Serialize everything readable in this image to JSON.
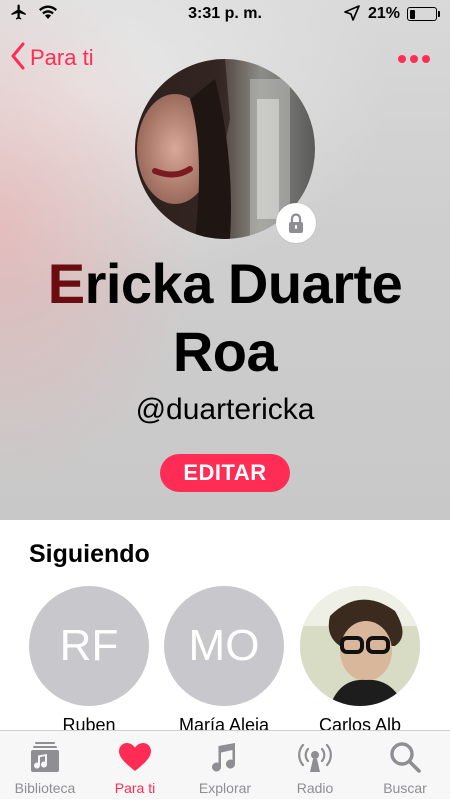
{
  "status_bar": {
    "time": "3:31 p. m.",
    "battery_text": "21%",
    "battery_level": 0.21
  },
  "nav": {
    "back_label": "Para ti",
    "more_icon": "more-dots-icon"
  },
  "profile": {
    "name_first_letter": "E",
    "name_first_rest": "ricka Duarte",
    "name_last": "Roa",
    "handle": "@duartericka",
    "edit_label": "EDITAR",
    "lock_icon": "lock-icon"
  },
  "following": {
    "title": "Siguiendo",
    "items": [
      {
        "initials": "RF",
        "name": "Ruben"
      },
      {
        "initials": "MO",
        "name": "María Aleja"
      },
      {
        "initials": "",
        "name": "Carlos Alb"
      }
    ]
  },
  "tabs": [
    {
      "label": "Biblioteca",
      "icon": "library-icon",
      "active": false
    },
    {
      "label": "Para ti",
      "icon": "heart-icon",
      "active": true
    },
    {
      "label": "Explorar",
      "icon": "music-note-icon",
      "active": false
    },
    {
      "label": "Radio",
      "icon": "radio-icon",
      "active": false
    },
    {
      "label": "Buscar",
      "icon": "search-icon",
      "active": false
    }
  ],
  "colors": {
    "accent": "#ff2d55",
    "inactive": "#8e8e93",
    "placeholder_avatar": "#c7c7cc"
  }
}
